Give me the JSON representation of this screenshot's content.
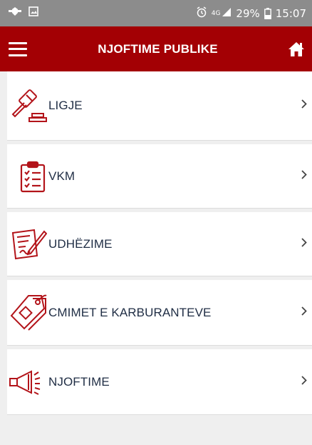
{
  "status_bar": {
    "network": "4G",
    "battery_percent": "29%",
    "time": "15:07"
  },
  "app_bar": {
    "title": "NJOFTIME PUBLIKE",
    "menu_icon": "hamburger-menu-icon",
    "home_icon": "home-icon"
  },
  "menu": {
    "items": [
      {
        "label": "LIGJE",
        "icon": "gavel-icon"
      },
      {
        "label": "VKM",
        "icon": "clipboard-checklist-icon"
      },
      {
        "label": "UDHËZIME",
        "icon": "document-signature-icon"
      },
      {
        "label": "CMIMET E KARBURANTEVE",
        "icon": "price-tag-icon"
      },
      {
        "label": "NJOFTIME",
        "icon": "megaphone-icon"
      }
    ]
  },
  "colors": {
    "app_bar": "#a30004",
    "status_bar": "#8c8c8c",
    "icon_red": "#b3141a",
    "label_text": "#1f2d44",
    "background": "#efefef"
  }
}
